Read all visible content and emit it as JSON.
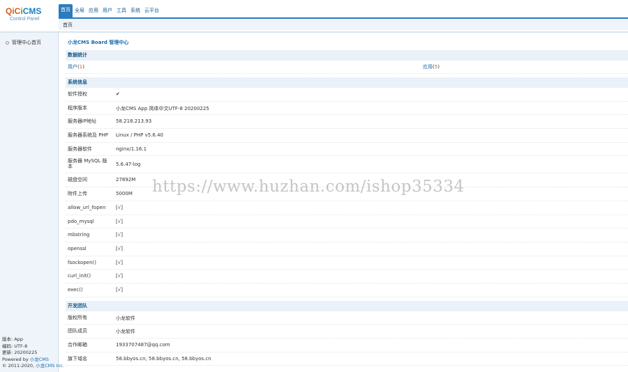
{
  "logo": {
    "part1": "QiC",
    "part2": "i",
    "part3": "CMS",
    "subtitle": "Control Panel"
  },
  "topnav": [
    {
      "label": "首页",
      "active": true
    },
    {
      "label": "全局",
      "active": false
    },
    {
      "label": "应用",
      "active": false
    },
    {
      "label": "用户",
      "active": false
    },
    {
      "label": "工具",
      "active": false
    },
    {
      "label": "系统",
      "active": false
    },
    {
      "label": "云平台",
      "active": false
    }
  ],
  "breadcrumb": "首页",
  "sidebar": {
    "items": [
      "管理中心首页"
    ]
  },
  "sidefoot": {
    "version": "版本: App",
    "charset": "编码: UTF-8",
    "updated": "更新: 20200225",
    "powered_prefix": "Powered by ",
    "powered_link": "小龙CMS",
    "copyright_prefix": "© 2011-2020, ",
    "copyright_link": "小龙CMS Inc."
  },
  "main": {
    "title": "小龙CMS Board 管理中心",
    "stats": {
      "heading": "数据统计",
      "users_label": "用户",
      "users_count": "1",
      "apps_label": "应用",
      "apps_count": "5"
    },
    "sysinfo": {
      "heading": "系统信息",
      "rows": [
        {
          "k": "软件授权",
          "v": "✔",
          "type": "check"
        },
        {
          "k": "程序版本",
          "v": "小龙CMS App 简体中文UTF-8 20200225"
        },
        {
          "k": "服务器IP地址",
          "v": "58.218.213.93"
        },
        {
          "k": "服务器系统及 PHP",
          "v": "Linux / PHP v5.6.40"
        },
        {
          "k": "服务器软件",
          "v": "nginx/1.16.1"
        },
        {
          "k": "服务器 MySQL 版本",
          "v": "5.6.47-log",
          "tall": true
        },
        {
          "k": "磁盘空间",
          "v": "27892M"
        },
        {
          "k": "附件上传",
          "v": "5000M"
        },
        {
          "k": "allow_url_fopen",
          "v": "[√]",
          "type": "ok"
        },
        {
          "k": "pdo_mysql",
          "v": "[√]",
          "type": "ok"
        },
        {
          "k": "mbstring",
          "v": "[√]",
          "type": "ok"
        },
        {
          "k": "openssl",
          "v": "[√]",
          "type": "ok"
        },
        {
          "k": "fsockopen()",
          "v": "[√]",
          "type": "ok"
        },
        {
          "k": "curl_init()",
          "v": "[√]",
          "type": "ok"
        },
        {
          "k": "exec()",
          "v": "[√]",
          "type": "ok"
        }
      ]
    },
    "team": {
      "heading": "开发团队",
      "rows": [
        {
          "k": "版权所有",
          "v": "小龙软件"
        },
        {
          "k": "团队成员",
          "v": "小龙软件"
        },
        {
          "k": "合作邮箱",
          "v": "1933707487@qq.com"
        },
        {
          "k": "旗下域名",
          "v": "58.bbyos.cn, 58.bbyos.cn, 58.bbyos.cn"
        }
      ]
    }
  },
  "watermark": "https://www.huzhan.com/ishop35334"
}
